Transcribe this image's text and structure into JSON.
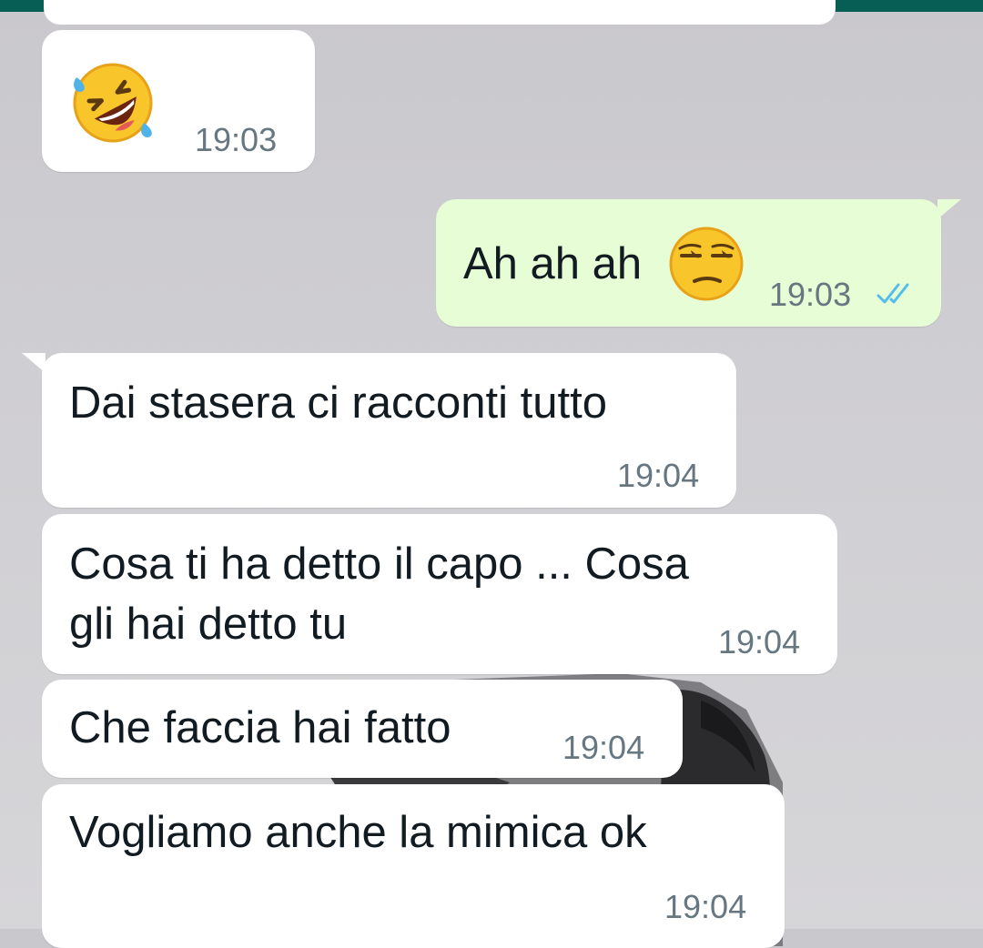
{
  "colors": {
    "header": "#075e54",
    "incoming_bubble": "#ffffff",
    "outgoing_bubble": "#e7fdd5",
    "timestamp": "#667781",
    "read_ticks": "#53bdeb"
  },
  "messages": [
    {
      "direction": "incoming",
      "emoji": "rolling-on-floor-laughing-emoji",
      "time": "19:03"
    },
    {
      "direction": "outgoing",
      "text": "Ah ah ah",
      "emoji": "unamused-face-emoji",
      "time": "19:03",
      "status_icon": "double-check-read-icon"
    },
    {
      "direction": "incoming",
      "text": "Dai stasera ci racconti tutto",
      "time": "19:04"
    },
    {
      "direction": "incoming",
      "text_line1": "Cosa ti ha detto il capo ... Cosa",
      "text_line2": "gli hai detto tu",
      "time": "19:04"
    },
    {
      "direction": "incoming",
      "text": "Che faccia hai fatto",
      "time": "19:04"
    },
    {
      "direction": "incoming",
      "text": "Vogliamo anche la mimica ok",
      "time": "19:04"
    }
  ]
}
